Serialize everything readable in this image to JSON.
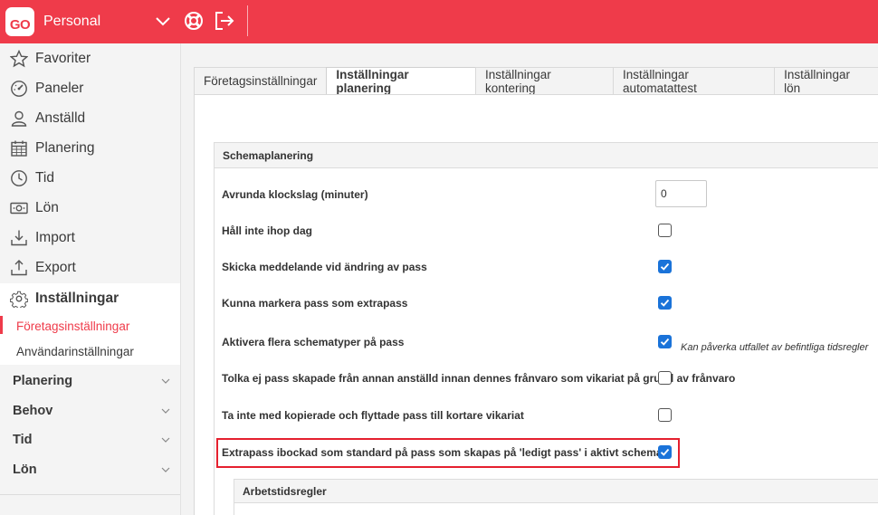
{
  "app": {
    "logo": "GO",
    "title": "Personal"
  },
  "topbar": {
    "icons": [
      "chevron-down-icon",
      "lifebuoy-icon",
      "logout-icon"
    ]
  },
  "sidebar": {
    "items": [
      {
        "label": "Favoriter",
        "icon": "star-icon"
      },
      {
        "label": "Paneler",
        "icon": "gauge-icon"
      },
      {
        "label": "Anställd",
        "icon": "person-icon"
      },
      {
        "label": "Planering",
        "icon": "calendar-icon"
      },
      {
        "label": "Tid",
        "icon": "clock-icon"
      },
      {
        "label": "Lön",
        "icon": "money-icon"
      },
      {
        "label": "Import",
        "icon": "import-icon"
      },
      {
        "label": "Export",
        "icon": "export-icon"
      },
      {
        "label": "Inställningar",
        "icon": "gear-icon"
      }
    ],
    "sub_items": [
      {
        "label": "Företagsinställningar",
        "active": true
      },
      {
        "label": "Användarinställningar",
        "active": false
      }
    ],
    "groups": [
      {
        "label": "Planering"
      },
      {
        "label": "Behov"
      },
      {
        "label": "Tid"
      },
      {
        "label": "Lön"
      }
    ]
  },
  "tabs": [
    {
      "label": "Företagsinställningar",
      "active": false
    },
    {
      "label": "Inställningar planering",
      "active": true
    },
    {
      "label": "Inställningar kontering",
      "active": false
    },
    {
      "label": "Inställningar automatattest",
      "active": false
    },
    {
      "label": "Inställningar lön",
      "active": false
    }
  ],
  "section": {
    "title": "Schemaplanering",
    "rows": [
      {
        "label": "Avrunda klockslag (minuter)",
        "type": "number",
        "value": "0"
      },
      {
        "label": "Håll inte ihop dag",
        "type": "checkbox",
        "checked": false
      },
      {
        "label": "Skicka meddelande vid ändring av pass",
        "type": "checkbox",
        "checked": true
      },
      {
        "label": "Kunna markera pass som extrapass",
        "type": "checkbox",
        "checked": true
      },
      {
        "label": "Aktivera flera schematyper på pass",
        "type": "checkbox",
        "checked": true,
        "hint": "Kan påverka utfallet av befintliga tidsregler"
      },
      {
        "label": "Tolka ej pass skapade från annan anställd innan dennes frånvaro som vikariat på grund av frånvaro",
        "type": "checkbox",
        "checked": false
      },
      {
        "label": "Ta inte med kopierade och flyttade pass till kortare vikariat",
        "type": "checkbox",
        "checked": false
      },
      {
        "label": "Extrapass ibockad som standard på pass som skapas på 'ledigt pass' i aktivt schema",
        "type": "checkbox",
        "checked": true
      }
    ],
    "subsection_title": "Arbetstidsregler"
  },
  "colors": {
    "brand": "#ef3b4a",
    "checkbox": "#1a73d9",
    "highlight": "#e5202e"
  }
}
